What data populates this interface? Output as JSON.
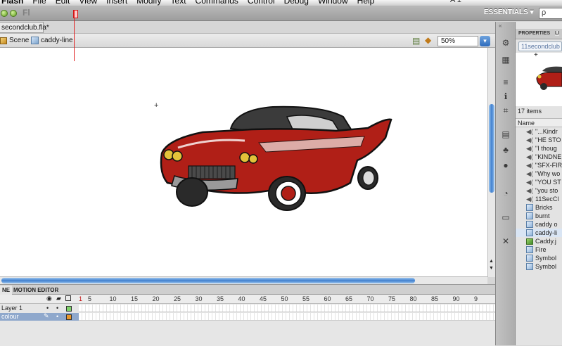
{
  "menubar": {
    "items": [
      "Flash",
      "File",
      "Edit",
      "View",
      "Insert",
      "Modify",
      "Text",
      "Commands",
      "Control",
      "Debug",
      "Window",
      "Help"
    ],
    "status_text": "A 1"
  },
  "appbar": {
    "logo_text": "Fl",
    "workspace_label": "ESSENTIALS ▾",
    "search_placeholder": "ρ"
  },
  "document": {
    "tab_label": "secondclub.fla*"
  },
  "editbar": {
    "scene_label": "Scene 1",
    "symbol_label": "caddy-line",
    "zoom_value": "50%",
    "zoom_button": "▾"
  },
  "timeline": {
    "tabs": [
      "NE",
      "MOTION EDITOR"
    ],
    "frame_numbers": [
      "1",
      "5",
      "10",
      "15",
      "20",
      "25",
      "30",
      "35",
      "40",
      "45",
      "50",
      "55",
      "60",
      "65",
      "70",
      "75",
      "80",
      "85",
      "90",
      "9"
    ],
    "layers": [
      {
        "name": "Layer 1",
        "color": "#7fd36a"
      },
      {
        "name": "colour",
        "color": "#e8962a"
      }
    ]
  },
  "panel": {
    "tabs": [
      "PROPERTIES",
      "LI"
    ],
    "library_dropdown": "11secondclub",
    "item_count": "17 items",
    "column_name": "Name",
    "items": [
      {
        "name": "\"...Kindr",
        "type": "sound"
      },
      {
        "name": "\"HE STO",
        "type": "sound"
      },
      {
        "name": "\"I thoug",
        "type": "sound"
      },
      {
        "name": "\"KINDNE",
        "type": "sound"
      },
      {
        "name": "\"SFX-FIR",
        "type": "sound"
      },
      {
        "name": "\"Why wo",
        "type": "sound"
      },
      {
        "name": "\"YOU ST",
        "type": "sound"
      },
      {
        "name": "\"you sto",
        "type": "sound"
      },
      {
        "name": "11SecCl",
        "type": "sound"
      },
      {
        "name": "Bricks",
        "type": "symbol"
      },
      {
        "name": "burnt",
        "type": "symbol"
      },
      {
        "name": "caddy o",
        "type": "symbol"
      },
      {
        "name": "caddy-li",
        "type": "symbol"
      },
      {
        "name": "Caddy.j",
        "type": "bitmap"
      },
      {
        "name": "Fire",
        "type": "symbol"
      },
      {
        "name": "Symbol",
        "type": "symbol"
      },
      {
        "name": "Symbol",
        "type": "symbol"
      }
    ]
  },
  "colors": {
    "car_body": "#b01f17",
    "car_top": "#3b3b3b",
    "selection_blue": "#3f7fcf",
    "playhead": "#e02020"
  }
}
